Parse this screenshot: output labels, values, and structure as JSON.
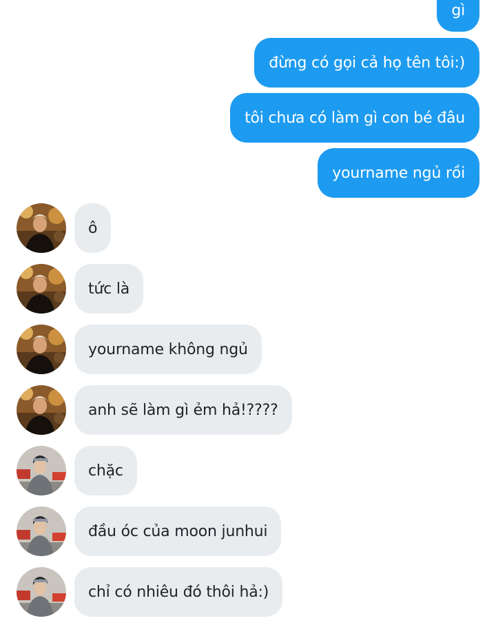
{
  "conversation": {
    "messages": [
      {
        "id": "out-0",
        "direction": "outgoing",
        "text": "gì"
      },
      {
        "id": "out-1",
        "direction": "outgoing",
        "text": "đừng có gọi cả họ tên tôi:)"
      },
      {
        "id": "out-2",
        "direction": "outgoing",
        "text": "tôi chưa có làm gì con bé đâu"
      },
      {
        "id": "out-3",
        "direction": "outgoing",
        "text": "yourname ngủ rồi"
      },
      {
        "id": "in-0",
        "direction": "incoming",
        "avatar": "person-a",
        "text": "ô"
      },
      {
        "id": "in-1",
        "direction": "incoming",
        "avatar": "person-a",
        "text": "tức là"
      },
      {
        "id": "in-2",
        "direction": "incoming",
        "avatar": "person-a",
        "text": "yourname không ngủ"
      },
      {
        "id": "in-3",
        "direction": "incoming",
        "avatar": "person-a",
        "text": "anh sẽ làm gì ẻm hả!????"
      },
      {
        "id": "in-4",
        "direction": "incoming",
        "avatar": "person-b",
        "text": "chặc"
      },
      {
        "id": "in-5",
        "direction": "incoming",
        "avatar": "person-b",
        "text": "đầu óc của moon junhui"
      },
      {
        "id": "in-6",
        "direction": "incoming",
        "avatar": "person-b",
        "text": "chỉ có nhiêu đó thôi hả:)"
      }
    ]
  },
  "colors": {
    "outgoing_bubble": "#1d9bf0",
    "incoming_bubble": "#e9ecef",
    "outgoing_text": "#ffffff",
    "incoming_text": "#1f2328"
  }
}
